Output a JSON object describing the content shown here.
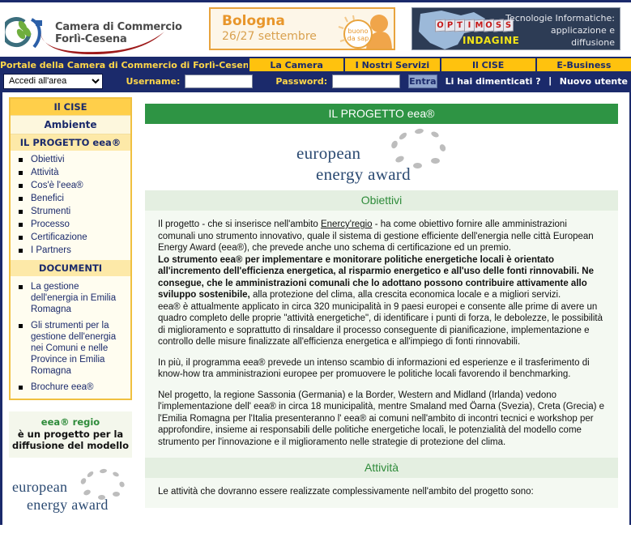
{
  "banners": {
    "camera": {
      "line1": "Camera di Commercio",
      "line2": "Forlì-Cesena",
      "logo_name": "camera-commercio-logo"
    },
    "bologna": {
      "title": "Bologna",
      "date": "26/27 settembre",
      "badge_text": "buono da sapere"
    },
    "indagine": {
      "dice_letters": [
        "O",
        "P",
        "T",
        "I",
        "M",
        "O",
        "S",
        "S"
      ],
      "word": "INDAGINE",
      "line1": "Tecnologie Informatiche:",
      "line2": "applicazione e",
      "line3": "diffusione"
    }
  },
  "nav": {
    "portal_label": "Portale della Camera di Commercio di Forlì-Cesena",
    "tabs": [
      {
        "label": "La Camera"
      },
      {
        "label": "I Nostri Servizi"
      },
      {
        "label": "Il CISE"
      },
      {
        "label": "E-Business"
      }
    ]
  },
  "login": {
    "area_select_value": "Accedi all'area",
    "area_options": [
      "Accedi all'area"
    ],
    "username_label": "Username:",
    "username_value": "",
    "password_label": "Password:",
    "password_value": "",
    "submit_label": "Entra",
    "forgot_label": "Li hai dimenticati ?",
    "separator": "|",
    "new_user_label": "Nuovo utente"
  },
  "sidebar": {
    "header_cise": "Il CISE",
    "header_ambiente": "Ambiente",
    "section_progetto": "IL PROGETTO eea®",
    "progetto_items": [
      {
        "label": "Obiettivi"
      },
      {
        "label": "Attività"
      },
      {
        "label": "Cos'è l'eea®"
      },
      {
        "label": "Benefici"
      },
      {
        "label": "Strumenti"
      },
      {
        "label": "Processo"
      },
      {
        "label": "Certificazione"
      },
      {
        "label": "I Partners"
      }
    ],
    "section_documenti": "DOCUMENTI",
    "documenti_items": [
      {
        "label": "La gestione dell'energia in Emilia Romagna"
      },
      {
        "label": "Gli strumenti per la gestione dell'energia nei Comuni e nelle Province in Emilia Romagna"
      },
      {
        "label": "Brochure eea®"
      }
    ],
    "slogan_line1": "eea® regio",
    "slogan_line2": "è un progetto per la diffusione del modello",
    "logo_word1": "european",
    "logo_word2": "energy award"
  },
  "main": {
    "page_title": "IL PROGETTO eea®",
    "logo_word1": "european",
    "logo_word2": "energy award",
    "sections": [
      {
        "heading": "Obiettivi",
        "paragraphs": [
          {
            "parts": [
              {
                "text": "Il progetto - che si inserisce nell'ambito ",
                "style": "normal"
              },
              {
                "text": "Enercy'regio",
                "style": "link"
              },
              {
                "text": " - ha come obiettivo fornire alle amministrazioni comunali uno strumento innovativo, quale il sistema di gestione efficiente dell'energia nelle città European Energy Award (eea®), che prevede anche uno schema di certificazione ed un premio.",
                "style": "normal"
              },
              {
                "text": "Lo strumento eea® per implementare e monitorare politiche energetiche locali è orientato all'incremento dell'efficienza energetica, al risparmio energetico e all'uso delle fonti rinnovabili. Ne consegue, che le amministrazioni comunali che lo adottano possono contribuire attivamente allo sviluppo sostenibile,",
                "style": "bold",
                "newline": true
              },
              {
                "text": " alla protezione del clima, alla crescita economica locale e a migliori servizi.",
                "style": "normal"
              },
              {
                "text": "eea® è attualmente applicato in circa 320 municipalità in 9 paesi europei e consente alle prime di avere un quadro completo delle proprie \"attività energetiche\", di identificare i punti di forza, le debolezze, le possibilità di miglioramento e soprattutto di rinsaldare il processo conseguente di pianificazione, implementazione e controllo delle misure finalizzate all'efficienza energetica e all'impiego di fonti rinnovabili.",
                "style": "normal",
                "newline": true
              }
            ]
          },
          {
            "parts": [
              {
                "text": "In più, il programma eea® prevede un intenso scambio di informazioni ed esperienze e il trasferimento di know-how tra amministrazioni europee per promuovere le politiche locali favorendo il benchmarking.",
                "style": "normal"
              }
            ]
          },
          {
            "parts": [
              {
                "text": "Nel progetto, la regione Sassonia (Germania) e la Border, Western and Midland (Irlanda) vedono l'implementazione dell' eea® in circa 18 municipalità, mentre Smaland med Öarna (Svezia), Creta (Grecia) e l'Emilia Romagna per l'Italia presenteranno l' eea® ai comuni nell'ambito di incontri tecnici e workshop per approfondire, insieme ai responsabili delle politiche energetiche locali, le potenzialità del modello come strumento per l'innovazione e il miglioramento nelle strategie di protezione del clima.",
                "style": "normal"
              }
            ]
          }
        ]
      },
      {
        "heading": "Attività",
        "paragraphs": [
          {
            "parts": [
              {
                "text": "Le attività che dovranno essere realizzate complessivamente nell'ambito del progetto sono:",
                "style": "normal"
              }
            ]
          }
        ]
      }
    ]
  },
  "colors": {
    "nav_blue": "#1b2a6b",
    "nav_yellow": "#ffc20e",
    "green_header": "#2e9444",
    "green_soft": "#e4efe1",
    "sidebar_border": "#f0c040"
  }
}
